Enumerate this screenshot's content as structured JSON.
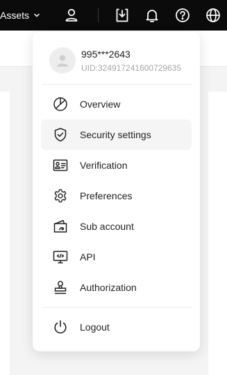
{
  "topbar": {
    "assets_label": "Assets"
  },
  "account_menu": {
    "user": {
      "name": "995***2643",
      "uid": "UID:324917241600729635"
    },
    "items": [
      {
        "label": "Overview",
        "icon": "pie-chart-icon",
        "active": false
      },
      {
        "label": "Security settings",
        "icon": "shield-check-icon",
        "active": true
      },
      {
        "label": "Verification",
        "icon": "id-card-icon",
        "active": false
      },
      {
        "label": "Preferences",
        "icon": "gear-icon",
        "active": false
      },
      {
        "label": "Sub account",
        "icon": "wallet-icon",
        "active": false
      },
      {
        "label": "API",
        "icon": "code-monitor-icon",
        "active": false
      },
      {
        "label": "Authorization",
        "icon": "stamp-icon",
        "active": false
      }
    ],
    "logout_label": "Logout"
  },
  "colors": {
    "topbar_bg": "#0b0b0b",
    "active_item_bg": "#f5f5f5",
    "uid_text": "#a6a6a6"
  }
}
